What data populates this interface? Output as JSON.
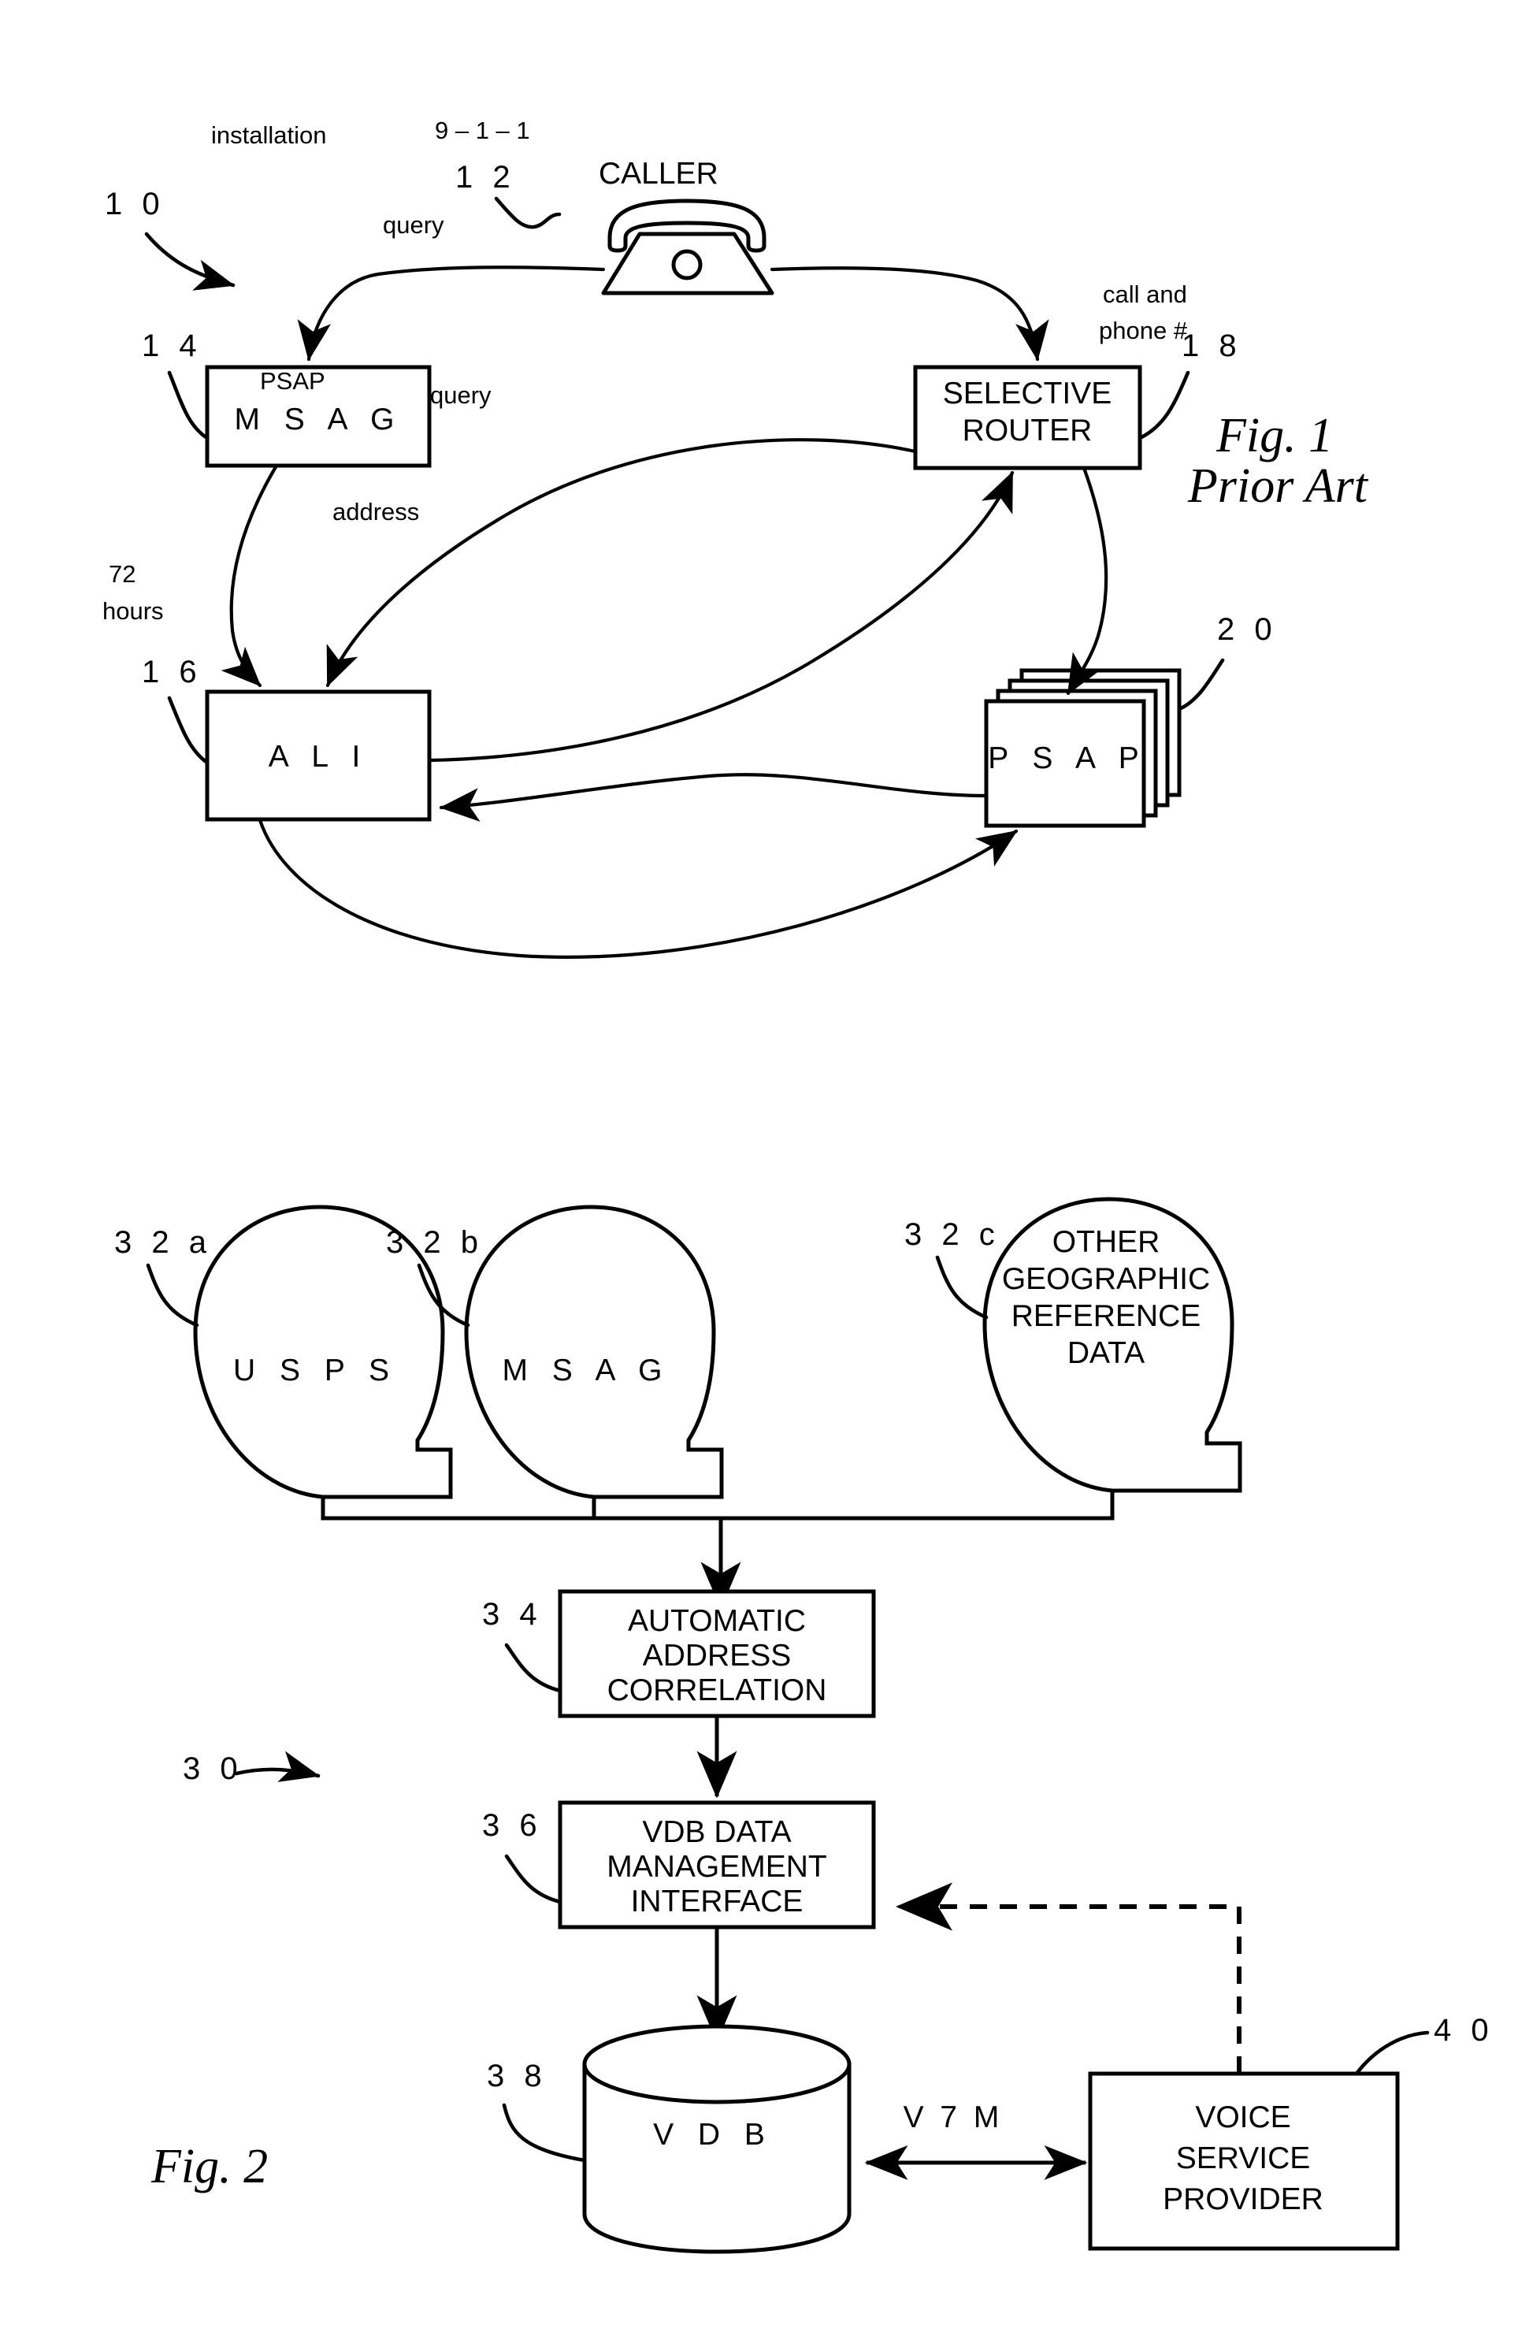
{
  "document": {
    "type": "patent-drawing-sheet",
    "figures": [
      {
        "id": "fig1",
        "caption_line1": "Fig. 1",
        "caption_line2": "Prior Art",
        "system_ref": "1 0",
        "nodes": [
          {
            "id": "caller",
            "ref": "1 2",
            "label": "CALLER",
            "shape": "telephone-icon"
          },
          {
            "id": "msag",
            "ref": "1 4",
            "label": "M S A G",
            "shape": "rect"
          },
          {
            "id": "ali",
            "ref": "1 6",
            "label": "A L I",
            "shape": "rect"
          },
          {
            "id": "router",
            "ref": "1 8",
            "label_line1": "SELECTIVE",
            "label_line2": "ROUTER",
            "shape": "rect"
          },
          {
            "id": "psap",
            "ref": "2 0",
            "label": "P S A P",
            "shape": "stacked-rect"
          }
        ],
        "edges": [
          {
            "from": "caller",
            "to": "msag",
            "label": "installation"
          },
          {
            "from": "caller",
            "to": "router",
            "label": "9 – 1 – 1"
          },
          {
            "from": "msag",
            "to": "ali",
            "label_line1": "72",
            "label_line2": "hours"
          },
          {
            "from": "router",
            "to": "ali",
            "label": "query"
          },
          {
            "from": "ali",
            "to": "router",
            "label": "PSAP"
          },
          {
            "from": "router",
            "to": "psap",
            "label_line1": "call and",
            "label_line2": "phone #"
          },
          {
            "from": "psap",
            "to": "ali",
            "label": "query"
          },
          {
            "from": "ali",
            "to": "psap",
            "label": "address"
          }
        ]
      },
      {
        "id": "fig2",
        "caption_line1": "Fig. 2",
        "system_ref": "3 0",
        "nodes": [
          {
            "id": "usps",
            "ref": "3 2 a",
            "label": "U S P S",
            "shape": "blob"
          },
          {
            "id": "msag2",
            "ref": "3 2 b",
            "label": "M S A G",
            "shape": "blob"
          },
          {
            "id": "other",
            "ref": "3 2 c",
            "label_line1": "OTHER",
            "label_line2": "GEOGRAPHIC",
            "label_line3": "REFERENCE",
            "label_line4": "DATA",
            "shape": "blob"
          },
          {
            "id": "aac",
            "ref": "3 4",
            "label_line1": "AUTOMATIC",
            "label_line2": "ADDRESS",
            "label_line3": "CORRELATION",
            "shape": "rect"
          },
          {
            "id": "vdbmi",
            "ref": "3 6",
            "label_line1": "VDB DATA",
            "label_line2": "MANAGEMENT",
            "label_line3": "INTERFACE",
            "shape": "rect"
          },
          {
            "id": "vdb",
            "ref": "3 8",
            "label": "V D B",
            "shape": "cylinder"
          },
          {
            "id": "vsp",
            "ref": "4 0",
            "label_line1": "VOICE",
            "label_line2": "SERVICE",
            "label_line3": "PROVIDER",
            "shape": "rect"
          }
        ],
        "edges": [
          {
            "from": "sources-bus",
            "to": "aac",
            "label": ""
          },
          {
            "from": "aac",
            "to": "vdbmi",
            "label": ""
          },
          {
            "from": "vdbmi",
            "to": "vdb",
            "label": ""
          },
          {
            "from": "vdb",
            "to": "vsp",
            "label": "V 7 M",
            "style": "double-arrow"
          },
          {
            "from": "vsp",
            "to": "vdbmi",
            "label": "",
            "style": "dashed-arrow"
          }
        ]
      }
    ]
  }
}
